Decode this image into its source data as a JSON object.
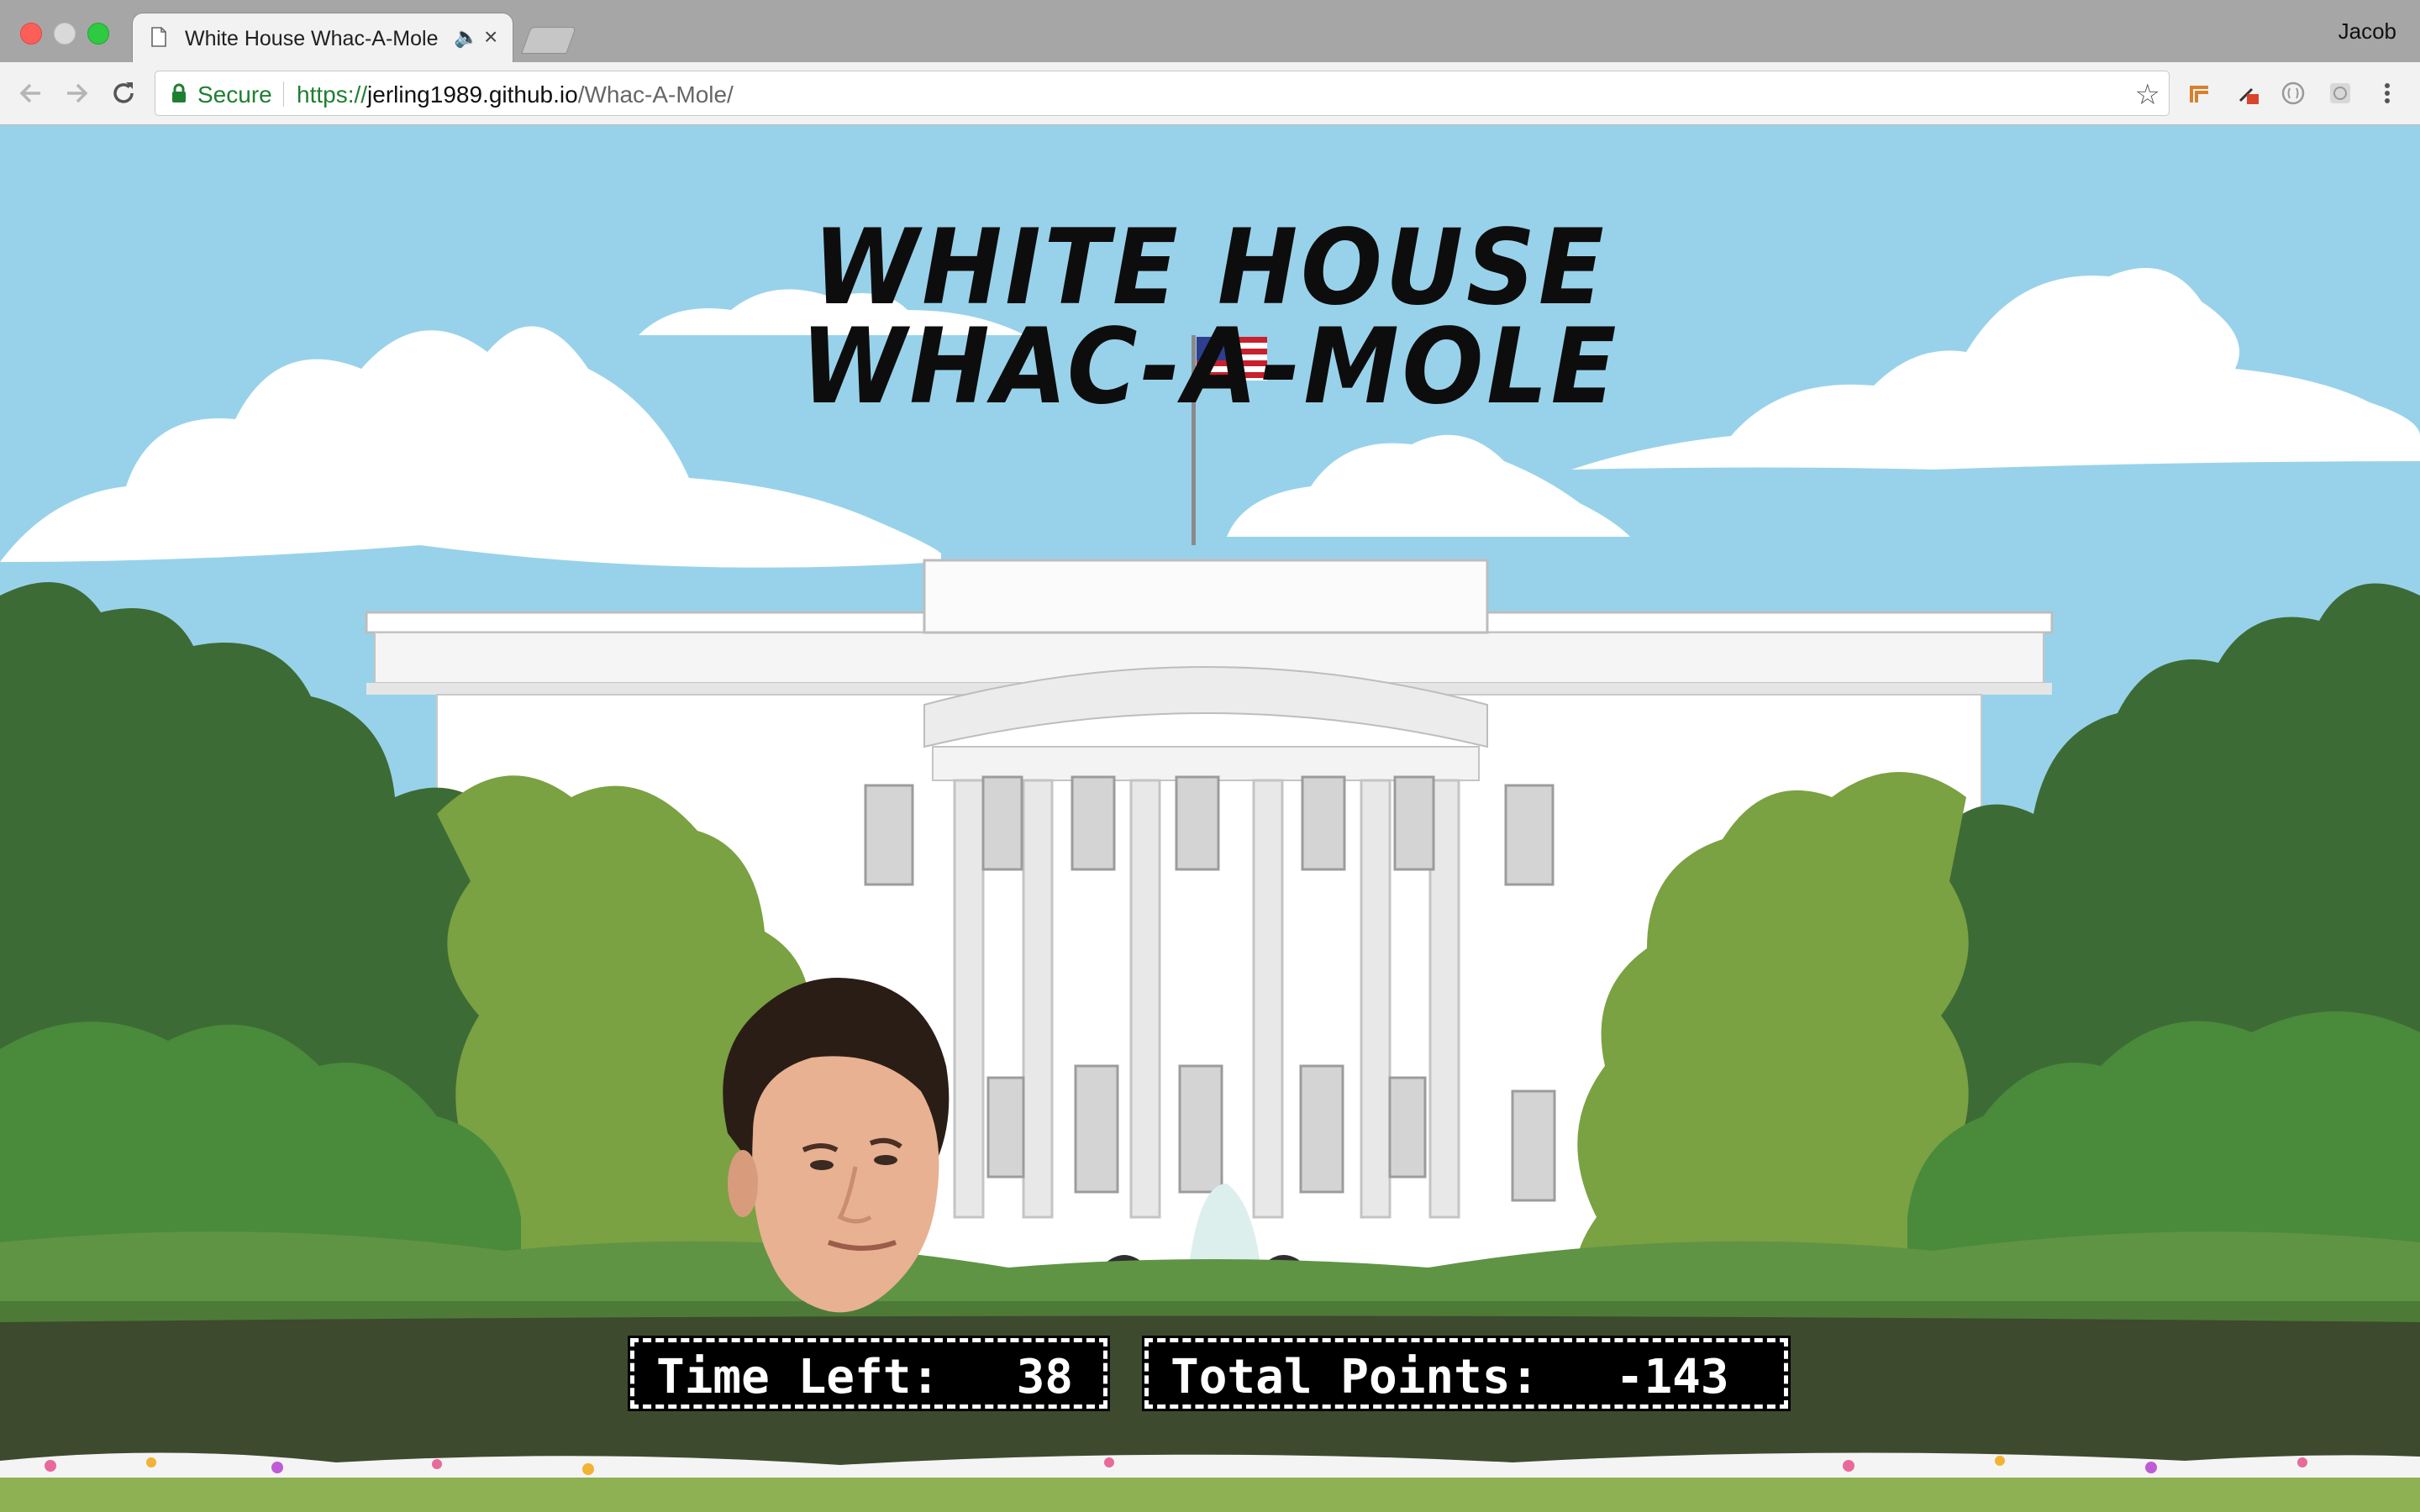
{
  "browser": {
    "tab_title": "White House Whac-A-Mole",
    "profile_name": "Jacob",
    "secure_label": "Secure",
    "url_scheme": "https://",
    "url_host": "jerling1989.github.io",
    "url_path": "/Whac-A-Mole/"
  },
  "game": {
    "title_line1": "WHITE HOUSE",
    "title_line2": "WHAC-A-MOLE",
    "time_label": "Time Left:",
    "time_value": "38",
    "points_label": "Total Points:",
    "points_value": "-143"
  },
  "colors": {
    "sky": "#98d2ea",
    "grass": "#8db153",
    "hedge": "#3d4a2e",
    "tree_dark": "#3d6b35",
    "tree_light": "#7aa142",
    "hud_bg": "#000000",
    "hud_text": "#ffffff"
  },
  "icons": [
    "page-icon",
    "audio-icon",
    "close-icon",
    "back-icon",
    "forward-icon",
    "reload-icon",
    "lock-icon",
    "star-icon",
    "extension-icon",
    "menu-icon"
  ]
}
